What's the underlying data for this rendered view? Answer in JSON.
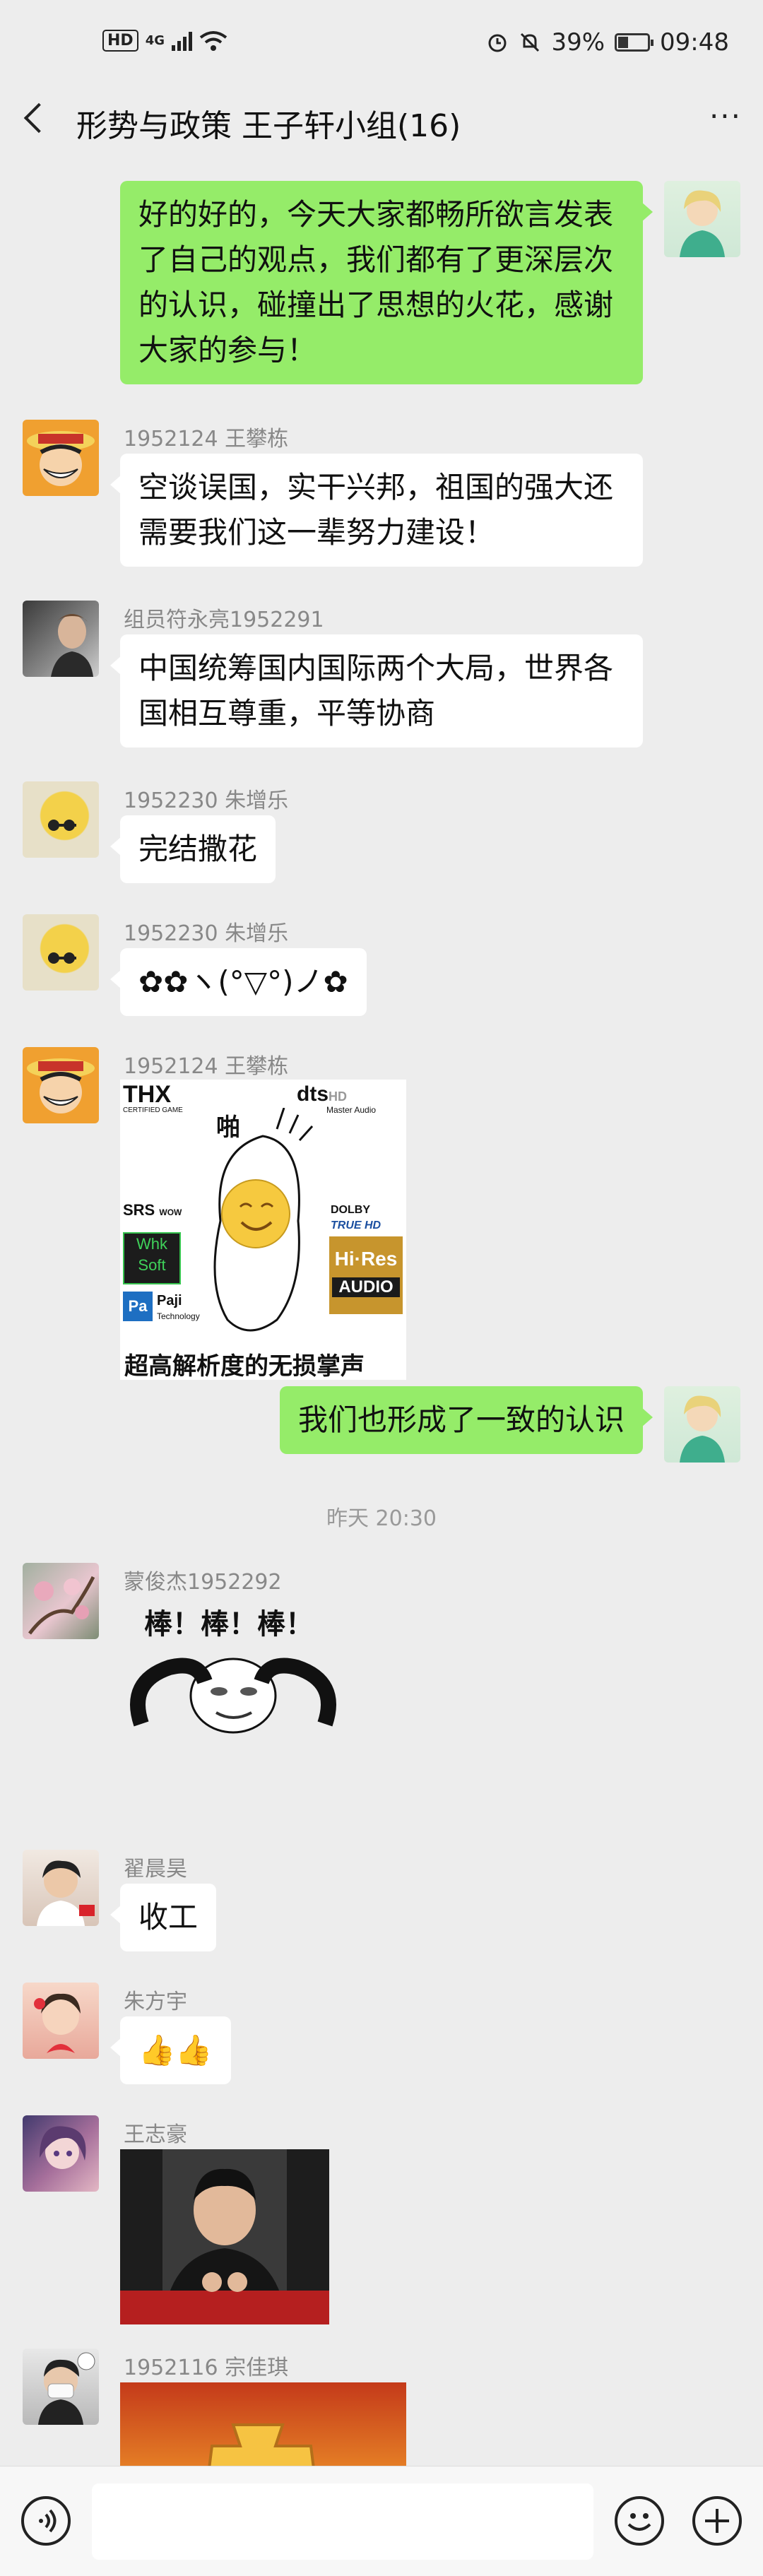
{
  "status_bar": {
    "hd": "HD",
    "network": "4G",
    "battery": "39%",
    "time": "09:48"
  },
  "header": {
    "title": "形势与政策 王子轩小组(16)",
    "more": "···"
  },
  "messages": [
    {
      "text": "好的好的，今天大家都畅所欲言发表了自己的观点，我们都有了更深层次的认识，碰撞出了思想的火花，感谢大家的参与！"
    },
    {
      "sender": "1952124 王攀栋",
      "text": "空谈误国，实干兴邦，祖国的强大还需要我们这一辈努力建设！"
    },
    {
      "sender": "组员符永亮1952291",
      "text": "中国统筹国内国际两个大局，世界各国相互尊重，平等协商"
    },
    {
      "sender": "1952230 朱增乐",
      "text": "完结撒花"
    },
    {
      "sender": "1952230 朱增乐",
      "text": "✿✿ヽ(°▽°)ノ✿"
    },
    {
      "sender": "1952124 王攀栋",
      "sticker": {
        "thx": "THX",
        "certified": "CERTIFIED GAME",
        "dts": "dts",
        "hd": "HD",
        "master": "Master Audio",
        "pa": "啪",
        "srs": "SRS",
        "wow": "WOW",
        "whk": "Whk",
        "soft": "Soft",
        "dolby": "DOLBY",
        "truehd": "TRUE HD",
        "hires": "Hi·Res",
        "audio": "AUDIO",
        "pajil": "Pa",
        "paji": "Paji",
        "tech": "Technology",
        "caption": "超高解析度的无损掌声"
      }
    },
    {
      "text": "我们也形成了一致的认识"
    },
    {
      "timestamp": "昨天 20:30"
    },
    {
      "sender": "蒙俊杰1952292",
      "sticker": {
        "caption": "棒！棒！棒！"
      }
    },
    {
      "sender": "翟晨昊",
      "text": "收工"
    },
    {
      "sender": "朱方宇",
      "text": "👍👍"
    },
    {
      "sender": "王志豪"
    },
    {
      "sender": "1952116 宗佳琪"
    }
  ]
}
